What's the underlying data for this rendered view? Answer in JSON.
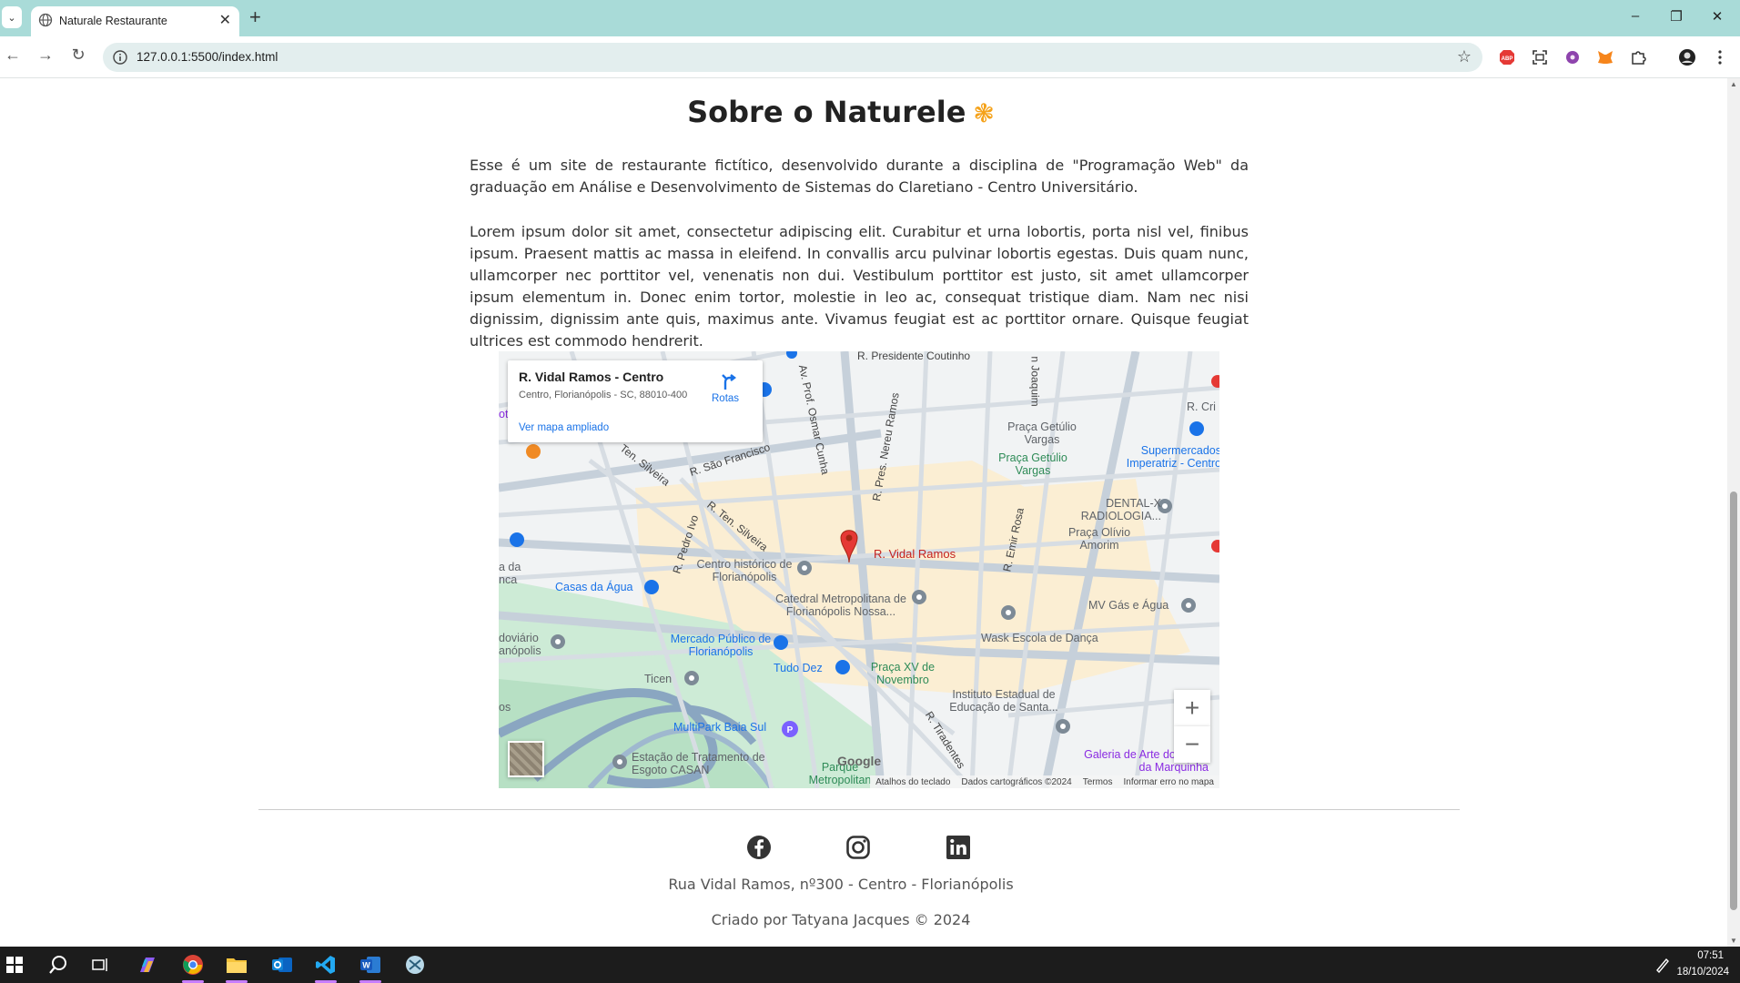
{
  "browser": {
    "tab_title": "Naturale Restaurante",
    "url": "127.0.0.1:5500/index.html"
  },
  "about": {
    "title": "Sobre o Naturele",
    "paragraph1": "Esse é um site de restaurante fictítico, desenvolvido durante a disciplina de \"Programação Web\" da graduação em Análise e Desenvolvimento de Sistemas do Claretiano - Centro Universitário.",
    "paragraph2": "Lorem ipsum dolor sit amet, consectetur adipiscing elit. Curabitur et urna lobortis, porta nisl vel, finibus ipsum. Praesent mattis ac massa in eleifend. In convallis arcu pulvinar lobortis egestas. Duis quam nunc, ullamcorper nec porttitor vel, venenatis non dui. Vestibulum porttitor est justo, sit amet ullamcorper ipsum elementum in. Donec enim tortor, molestie in leo ac, consequat tristique diam. Nam nec nisi dignissim, dignissim ante quis, maximus ante. Vivamus feugiat est ac porttitor ornare. Quisque feugiat ultrices est commodo hendrerit."
  },
  "map": {
    "place_name": "R. Vidal Ramos - Centro",
    "place_address": "Centro, Florianópolis - SC, 88010-400",
    "directions_label": "Rotas",
    "larger_map_link": "Ver mapa ampliado",
    "marker_label": "R. Vidal Ramos",
    "labels": {
      "presidente_coutinho": "R. Presidente Coutinho",
      "sao_francisco": "R. São Francisco",
      "ten_silveira_1": "Ten. Silveira",
      "ten_silveira_2": "R. Ten. Silveira",
      "pedro_ivo": "R. Pedro Ivo",
      "osmar_cunha": "Av. Prof. Osmar Cunha",
      "nereu_ramos": "R. Pres. Nereu Ramos",
      "emir_rosa": "R. Emir Rosa",
      "tiradentes": "R. Tiradentes",
      "joao": "n Joaquim",
      "praca_getulio_1": "Praça Getúlio Vargas",
      "praca_getulio_2": "Praça Getúlio Vargas",
      "supermercados": "Supermercados Imperatriz - Centro",
      "dental_x": "DENTAL-X RADIOLOGIA...",
      "praca_olivio": "Praça Olívio Amorim",
      "centro_historico": "Centro histórico de Florianópolis",
      "casas_agua": "Casas da Água",
      "catedral": "Catedral Metropolitana de Florianópolis Nossa...",
      "wask": "Wask Escola de Dança",
      "mv_gas": "MV Gás e Água",
      "mercado": "Mercado Público de Florianópolis",
      "tudo_dez": "Tudo Dez",
      "praca_xv": "Praça XV de Novembro",
      "ticen": "Ticen",
      "rodoviario": "doviário anópolis",
      "instituto": "Instituto Estadual de Educação de Santa...",
      "multipark": "MultiPark Baia Sul",
      "estacao": "Estação de Tratamento de Esgoto CASAN",
      "parque": "Parque Metropolitan",
      "galeria": "Galeria de Arte do Morro da Marquinha",
      "a_da": "a da nca",
      "r_cri": "R. Cri",
      "os": "os",
      "ot": "ot"
    },
    "footer": [
      "Atalhos do teclado",
      "Dados cartográficos ©2024",
      "Termos",
      "Informar erro no mapa"
    ],
    "google": "Google"
  },
  "footer": {
    "address": "Rua Vidal Ramos, nº300 - Centro - Florianópolis",
    "credit": "Criado por Tatyana Jacques © 2024"
  },
  "taskbar": {
    "time": "07:51",
    "date": "18/10/2024"
  }
}
